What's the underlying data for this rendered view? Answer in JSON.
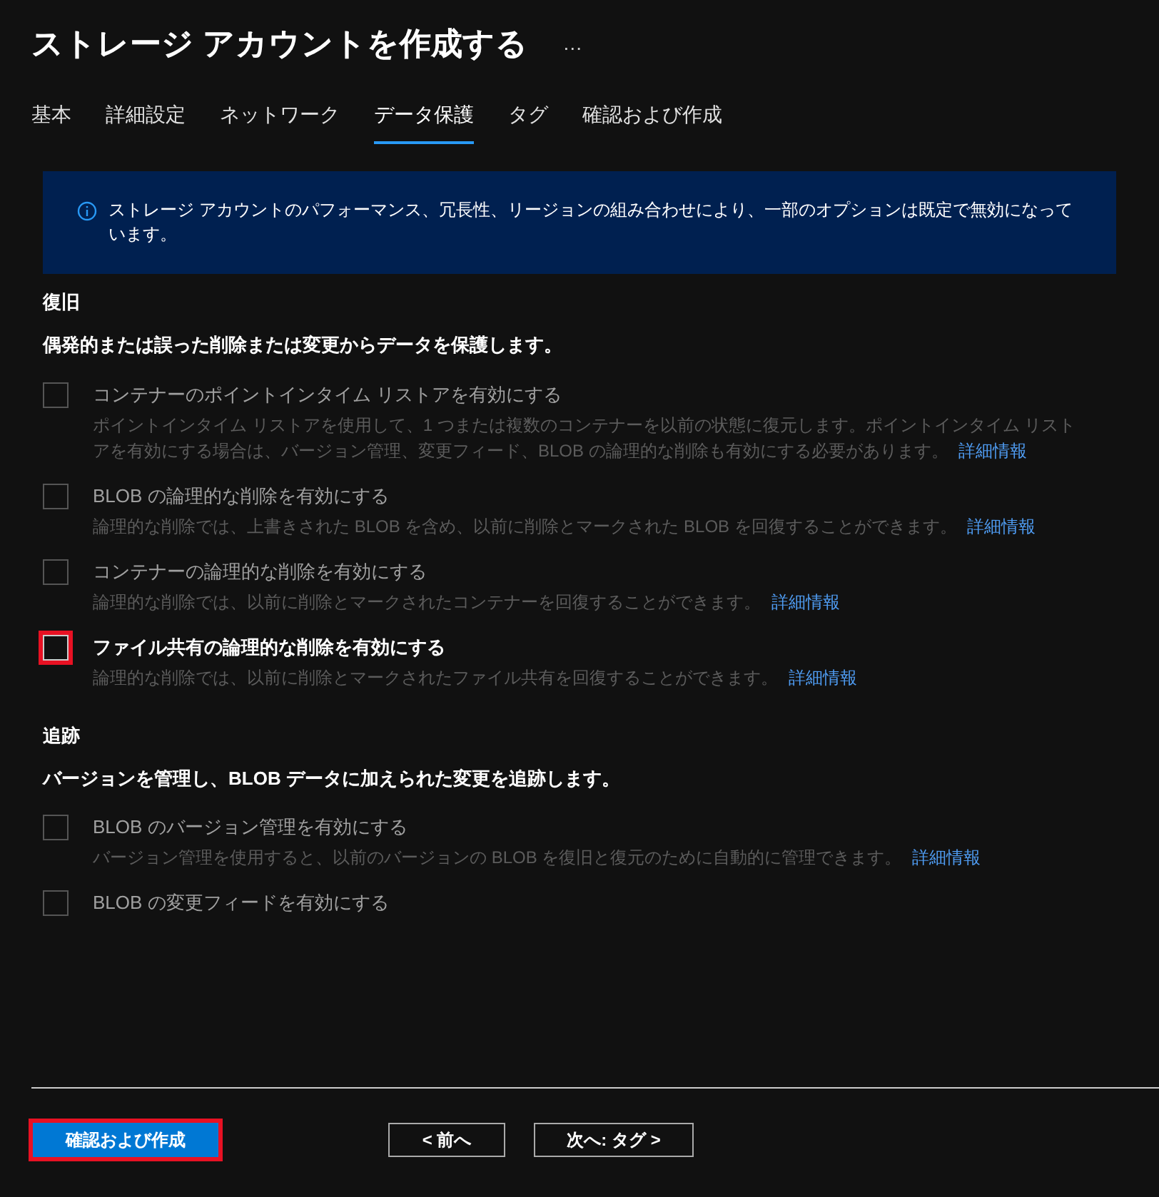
{
  "title": "ストレージ アカウントを作成する",
  "more": "…",
  "tabs": [
    {
      "label": "基本",
      "selected": false
    },
    {
      "label": "詳細設定",
      "selected": false
    },
    {
      "label": "ネットワーク",
      "selected": false
    },
    {
      "label": "データ保護",
      "selected": true
    },
    {
      "label": "タグ",
      "selected": false
    },
    {
      "label": "確認および作成",
      "selected": false
    }
  ],
  "info_banner": "ストレージ アカウントのパフォーマンス、冗長性、リージョンの組み合わせにより、一部のオプションは既定で無効になっています。",
  "sections": [
    {
      "heading": "復旧",
      "description": "偶発的または誤った削除または変更からデータを保護します。",
      "options": [
        {
          "label": "コンテナーのポイントインタイム リストアを有効にする",
          "checked": false,
          "disabled": true,
          "highlighted": false,
          "help": "ポイントインタイム リストアを使用して、1 つまたは複数のコンテナーを以前の状態に復元します。ポイントインタイム リストアを有効にする場合は、バージョン管理、変更フィード、BLOB の論理的な削除も有効にする必要があります。",
          "link": "詳細情報"
        },
        {
          "label": "BLOB の論理的な削除を有効にする",
          "checked": false,
          "disabled": true,
          "highlighted": false,
          "help": "論理的な削除では、上書きされた BLOB を含め、以前に削除とマークされた BLOB を回復することができます。",
          "link": "詳細情報"
        },
        {
          "label": "コンテナーの論理的な削除を有効にする",
          "checked": false,
          "disabled": true,
          "highlighted": false,
          "help": "論理的な削除では、以前に削除とマークされたコンテナーを回復することができます。",
          "link": "詳細情報"
        },
        {
          "label": "ファイル共有の論理的な削除を有効にする",
          "checked": false,
          "disabled": false,
          "highlighted": true,
          "help": "論理的な削除では、以前に削除とマークされたファイル共有を回復することができます。",
          "link": "詳細情報"
        }
      ]
    },
    {
      "heading": "追跡",
      "description": "バージョンを管理し、BLOB データに加えられた変更を追跡します。",
      "options": [
        {
          "label": "BLOB のバージョン管理を有効にする",
          "checked": false,
          "disabled": true,
          "highlighted": false,
          "help": "バージョン管理を使用すると、以前のバージョンの BLOB を復旧と復元のために自動的に管理できます。",
          "link": "詳細情報"
        },
        {
          "label": "BLOB の変更フィードを有効にする",
          "checked": false,
          "disabled": true,
          "highlighted": false
        }
      ]
    }
  ],
  "footer": {
    "primary": {
      "label": "確認および作成",
      "highlighted": true
    },
    "previous": "< 前へ",
    "next": "次へ: タグ >"
  }
}
